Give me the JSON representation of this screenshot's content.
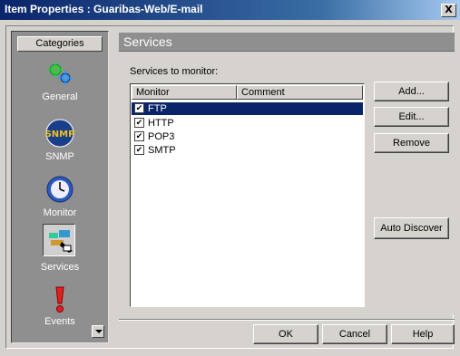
{
  "window": {
    "title": "Item Properties : Guaribas-Web/E-mail",
    "close_label": "X"
  },
  "sidebar": {
    "header": "Categories",
    "items": [
      {
        "label": "General",
        "icon": "gears-icon"
      },
      {
        "label": "SNMP",
        "icon": "snmp-icon",
        "icon_text": "SNMP"
      },
      {
        "label": "Monitor",
        "icon": "clock-icon"
      },
      {
        "label": "Services",
        "icon": "services-icon",
        "selected": true
      },
      {
        "label": "Events",
        "icon": "exclamation-icon"
      }
    ]
  },
  "main": {
    "title": "Services",
    "services_label": "Services to monitor:",
    "columns": [
      "Monitor",
      "Comment"
    ],
    "rows": [
      {
        "monitor": "FTP",
        "comment": "",
        "checked": true,
        "selected": true
      },
      {
        "monitor": "HTTP",
        "comment": "",
        "checked": true,
        "selected": false
      },
      {
        "monitor": "POP3",
        "comment": "",
        "checked": true,
        "selected": false
      },
      {
        "monitor": "SMTP",
        "comment": "",
        "checked": true,
        "selected": false
      }
    ],
    "buttons": {
      "add": "Add...",
      "edit": "Edit...",
      "remove": "Remove",
      "auto_discover": "Auto Discover"
    }
  },
  "footer": {
    "ok": "OK",
    "cancel": "Cancel",
    "help": "Help"
  },
  "colors": {
    "title_bar": "#0a246a",
    "selection": "#0a246a",
    "sidebar_bg": "#8f8f8f",
    "face": "#d6d3ce"
  }
}
